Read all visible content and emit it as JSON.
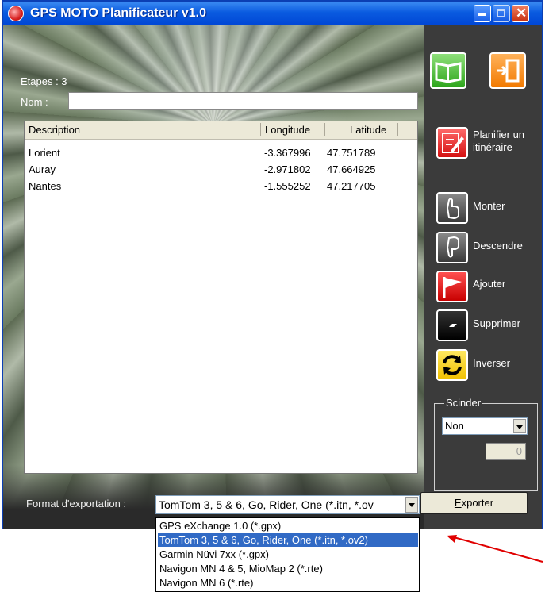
{
  "window": {
    "title": "GPS MOTO Planificateur v1.0"
  },
  "etapes_label": "Etapes : 3",
  "nom_label": "Nom :",
  "nom_value": "",
  "table": {
    "headers": [
      "Description",
      "Longitude",
      "Latitude"
    ],
    "rows": [
      {
        "description": "Lorient",
        "longitude": "-3.367996",
        "latitude": "47.751789"
      },
      {
        "description": "Auray",
        "longitude": "-2.971802",
        "latitude": "47.664925"
      },
      {
        "description": "Nantes",
        "longitude": "-1.555252",
        "latitude": "47.217705"
      }
    ]
  },
  "side": {
    "planifier": "Planifier un itinéraire",
    "monter": "Monter",
    "descendre": "Descendre",
    "ajouter": "Ajouter",
    "supprimer": "Supprimer",
    "inverser": "Inverser"
  },
  "scinder": {
    "legend": "Scinder",
    "selected": "Non",
    "number": "0"
  },
  "export": {
    "label": "Format d'exportation :",
    "selected": "TomTom 3, 5 & 6, Go, Rider, One (*.itn, *.ov",
    "button": "Exporter",
    "options": [
      "GPS eXchange 1.0 (*.gpx)",
      "TomTom 3, 5 & 6, Go, Rider, One (*.itn, *.ov2)",
      "Garmin Nüvi 7xx (*.gpx)",
      "Navigon MN 4 & 5, MioMap 2 (*.rte)",
      "Navigon MN 6 (*.rte)"
    ],
    "highlighted_index": 1
  },
  "colors": {
    "title_bar": "#0a5be0",
    "selection": "#316ac5",
    "annotation_arrow": "#e00000"
  }
}
